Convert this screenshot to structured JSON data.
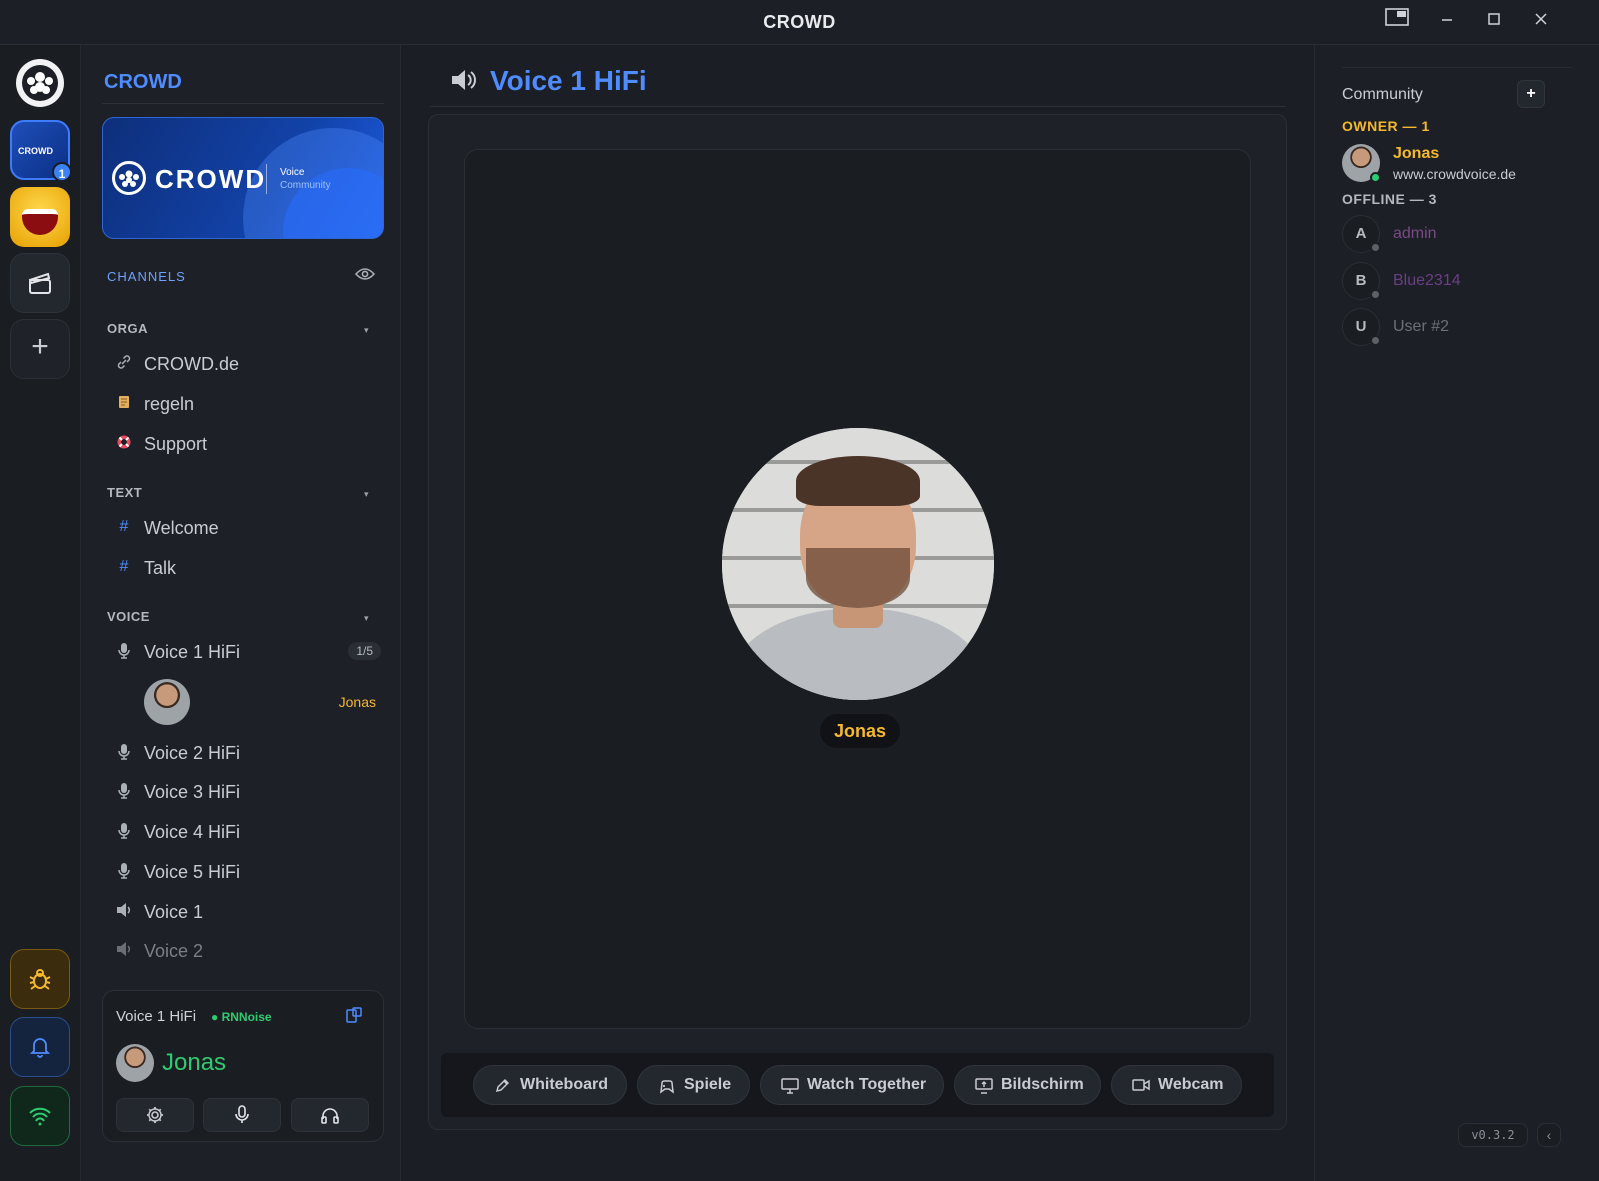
{
  "window": {
    "title": "CROWD"
  },
  "rail": {
    "server1_label": "CROWD",
    "server1_badge": "1",
    "add_label": "+"
  },
  "sidebar": {
    "title": "CROWD",
    "banner": {
      "name": "CROWD",
      "sub1": "Voice",
      "sub2": "Community"
    },
    "channels_heading": "CHANNELS",
    "categories": {
      "orga": "ORGA",
      "text": "TEXT",
      "voice": "VOICE"
    },
    "orga_channels": [
      "CROWD.de",
      "regeln",
      "Support"
    ],
    "text_channels": [
      "Welcome",
      "Talk"
    ],
    "voice_channels": [
      "Voice 1 HiFi",
      "Voice 2 HiFi",
      "Voice 3 HiFi",
      "Voice 4 HiFi",
      "Voice 5 HiFi",
      "Voice 1",
      "Voice 2"
    ],
    "voice1_count": "1/5",
    "voice1_member": "Jonas",
    "text_icon": "#"
  },
  "user_panel": {
    "channel": "Voice 1 HiFi",
    "noise": "RNNoise",
    "username": "Jonas"
  },
  "main": {
    "channel_title": "Voice 1 HiFi",
    "participant_name": "Jonas",
    "toolbar": [
      "Whiteboard",
      "Spiele",
      "Watch Together",
      "Bildschirm",
      "Webcam"
    ]
  },
  "members": {
    "title": "Community",
    "add_label": "+",
    "owner_group": "OWNER — 1",
    "owner": {
      "name": "Jonas",
      "status": "www.crowdvoice.de"
    },
    "offline_group": "OFFLINE — 3",
    "offline": [
      {
        "initial": "A",
        "name": "admin",
        "color": "#7a4a86"
      },
      {
        "initial": "B",
        "name": "Blue2314",
        "color": "#6a3f86"
      },
      {
        "initial": "U",
        "name": "User #2",
        "color": "#6b7078"
      }
    ],
    "version": "v0.3.2"
  },
  "colors": {
    "accent": "#4f8cff",
    "owner": "#f5b82e",
    "online": "#2ecc71"
  }
}
